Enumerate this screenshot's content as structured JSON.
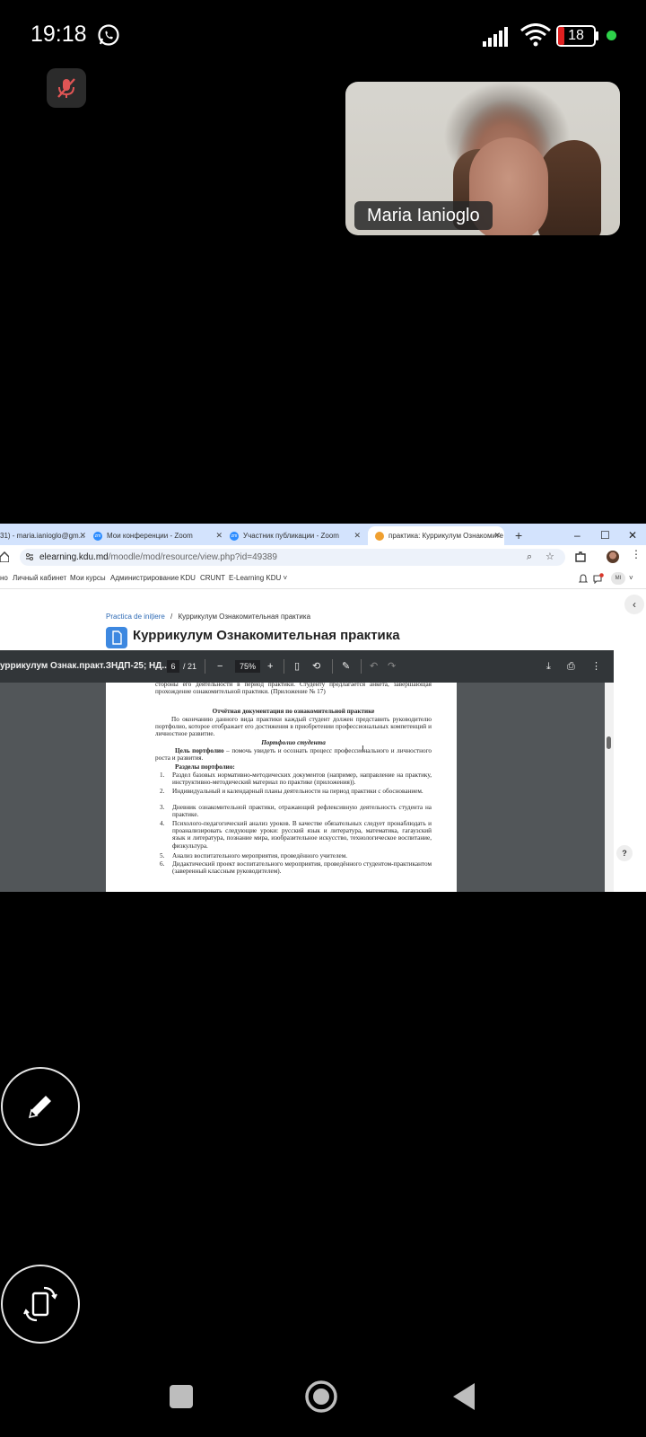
{
  "status_bar": {
    "time": "19:18",
    "battery": "18"
  },
  "participant": {
    "name": "Maria Ianioglo"
  },
  "browser": {
    "tabs": [
      {
        "label": "31) - maria.ianioglo@gm...",
        "icon": "gmail-icon"
      },
      {
        "label": "Мои конференции - Zoom",
        "icon": "zoom-icon"
      },
      {
        "label": "Участник публикации - Zoom",
        "icon": "zoom-icon"
      },
      {
        "label": "практика: Куррикулум Ознакомите",
        "icon": "moodle-icon"
      }
    ],
    "url_host": "elearning.kdu.md",
    "url_path": "/moodle/mod/resource/view.php?id=49389",
    "menu": [
      "но",
      "Личный кабинет",
      "Мои курсы",
      "Администрирование",
      "KDU",
      "CRUNT",
      "E-Learning KDU ˅"
    ],
    "avatar": "MI",
    "zoom_favicon": "zm"
  },
  "moodle": {
    "breadcrumb_parent": "Practica de inițiere",
    "breadcrumb_sep": "/",
    "breadcrumb_current": "Куррикулум Ознакомительная практика",
    "title": "Куррикулум Ознакомительная практика",
    "help": "?"
  },
  "pdf": {
    "filename": "уррикулум Ознак.практ.ЗНДП-25; НД...",
    "page": "6",
    "total": "/ 21",
    "zoom": "75%",
    "lines": {
      "l1": "стороны его деятельности в период практики. Студенту предлагается анкета, завершающая прохождение ознакомительной практики. (Приложение № 17)",
      "h1": "Отчётная документация по ознакомительной практике",
      "p1": "По окончанию данного вида практики каждый студент должен представить руководителю портфолио, которое отображает его достижения в приобретении профессиональных компетенций и личностное развитие.",
      "h2": "Портфолио студента",
      "goal_label": "Цель портфолио",
      "goal_text": " – помочь увидеть и осознать процесс профессионального и личностного роста и развития.",
      "sections_label": "Разделы портфолио:",
      "items": [
        {
          "n": "1.",
          "t": "Раздел базовых нормативно-методических документов (например, направление на практику, инструктивно-методический материал по практике (приложения))."
        },
        {
          "n": "2.",
          "t": "Индивидуальный и календарный планы деятельности на период практики с обоснованием."
        },
        {
          "n": "3.",
          "t": "Дневник ознакомительной практики, отражающий рефлексивную деятельность студента на практике."
        },
        {
          "n": "4.",
          "t": "Психолого-педагогический анализ уроков. В качестве обязательных следует пронаблюдать и проанализировать следующие уроки: русский язык и литература, математика, гагаузский язык и литература, познание мира, изобразительное искусство, технологическое воспитание, физкультура."
        },
        {
          "n": "5.",
          "t": "Анализ воспитательного мероприятия, проведённого учителем."
        },
        {
          "n": "6.",
          "t": "Дидактический проект воспитательного мероприятия, проведённого студентом-практикантом (заверенный классным руководителем)."
        }
      ]
    }
  }
}
